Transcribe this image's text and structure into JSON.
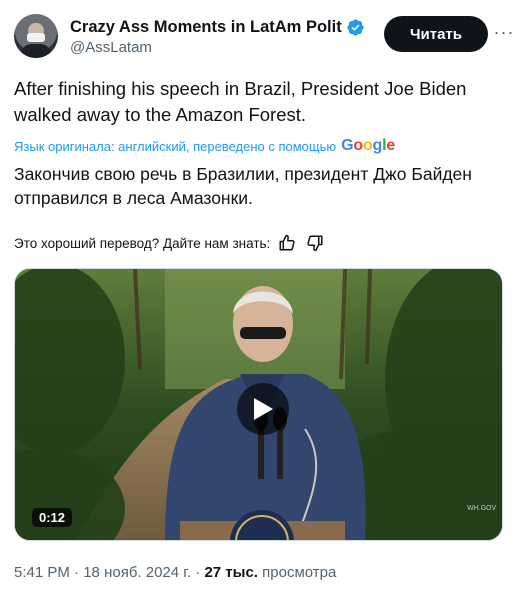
{
  "author": {
    "display_name": "Crazy Ass Moments in LatAm Polit",
    "handle": "@AssLatam",
    "avatar_icon": "avatar-image",
    "verified_icon": "verified-badge-icon",
    "verified_color": "#1d9bf0"
  },
  "actions": {
    "follow_label": "Читать",
    "more_icon": "more-icon",
    "more_glyph": "···"
  },
  "tweet": {
    "text": "After finishing his speech in Brazil, President Joe Biden walked away to the Amazon Forest.",
    "translated_by_label": "Язык оригинала: английский, переведено с помощью",
    "translation_provider": [
      "G",
      "o",
      "o",
      "g",
      "l",
      "e"
    ],
    "translated_text": "Закончив свою речь в Бразилии, президент Джо Байден отправился в леса Амазонки.",
    "feedback_prompt": "Это хороший перевод? Дайте нам знать:"
  },
  "video": {
    "duration": "0:12",
    "play_icon": "play-icon",
    "watermark": "WH.GOV"
  },
  "meta": {
    "time": "5:41 PM",
    "separator": "·",
    "date": "18 нояб. 2024 г.",
    "views_count": "27 тыс.",
    "views_label": "просмотра"
  },
  "colors": {
    "accent": "#1d9bf0",
    "text": "#0f1419",
    "muted": "#536471",
    "follow_bg": "#0f1419"
  }
}
